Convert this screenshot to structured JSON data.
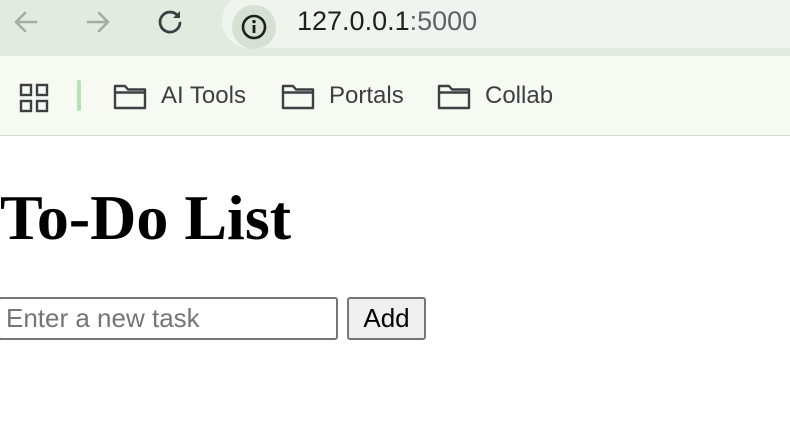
{
  "browser": {
    "url_host": "127.0.0.1",
    "url_port": ":5000"
  },
  "bookmarks": [
    {
      "label": "AI Tools"
    },
    {
      "label": "Portals"
    },
    {
      "label": "Collab"
    }
  ],
  "page": {
    "title": "To-Do List",
    "task_input": {
      "placeholder": "Enter a new task",
      "value": ""
    },
    "add_button_label": "Add"
  },
  "colors": {
    "toolbar_bg": "#e1ebe0",
    "bookmarks_bg": "#f6faf3",
    "separator_accent": "#b6e3ae"
  },
  "icons": {
    "back": "arrow-left-icon",
    "forward": "arrow-right-icon",
    "reload": "reload-icon",
    "site_info": "info-icon",
    "apps": "apps-grid-icon",
    "folder": "folder-icon"
  }
}
